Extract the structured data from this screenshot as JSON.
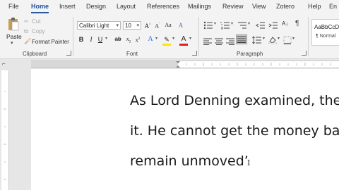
{
  "tabs": [
    "File",
    "Home",
    "Insert",
    "Design",
    "Layout",
    "References",
    "Mailings",
    "Review",
    "View",
    "Zotero",
    "Help",
    "En"
  ],
  "active_tab": "Home",
  "clipboard": {
    "paste": "Paste",
    "cut": "Cut",
    "copy": "Copy",
    "format_painter": "Format Painter",
    "group_label": "Clipboard"
  },
  "font": {
    "font_name": "Calibri Light",
    "font_size": "10",
    "group_label": "Font"
  },
  "paragraph": {
    "group_label": "Paragraph"
  },
  "styles": {
    "sample": "AaBbCcDd",
    "normal": "¶ Normal"
  },
  "document": {
    "lines": [
      "As Lord Denning examined, the",
      "it. He cannot get the money bac",
      "remain unmoved’"
    ]
  }
}
